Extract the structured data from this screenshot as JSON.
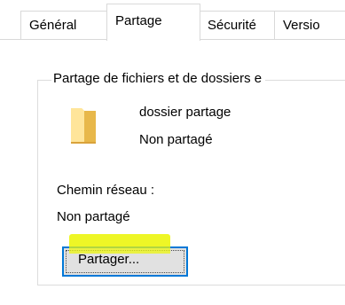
{
  "tabs": [
    {
      "label": "Général",
      "selected": false
    },
    {
      "label": "Partage",
      "selected": true
    },
    {
      "label": "Sécurité",
      "selected": false
    },
    {
      "label": "Versio",
      "selected": false
    }
  ],
  "sharing_group": {
    "title": "Partage de fichiers et de dossiers e",
    "folder_name": "dossier partage",
    "folder_status": "Non partagé",
    "network_path_label": "Chemin réseau :",
    "network_path_value": "Non partagé",
    "share_button_label": "Partager..."
  },
  "colors": {
    "accent": "#0078d7",
    "highlight": "#ecf50e",
    "folder": "#f8d775",
    "button_face": "#e1e1e1"
  },
  "icons": {
    "folder": "folder-icon"
  }
}
